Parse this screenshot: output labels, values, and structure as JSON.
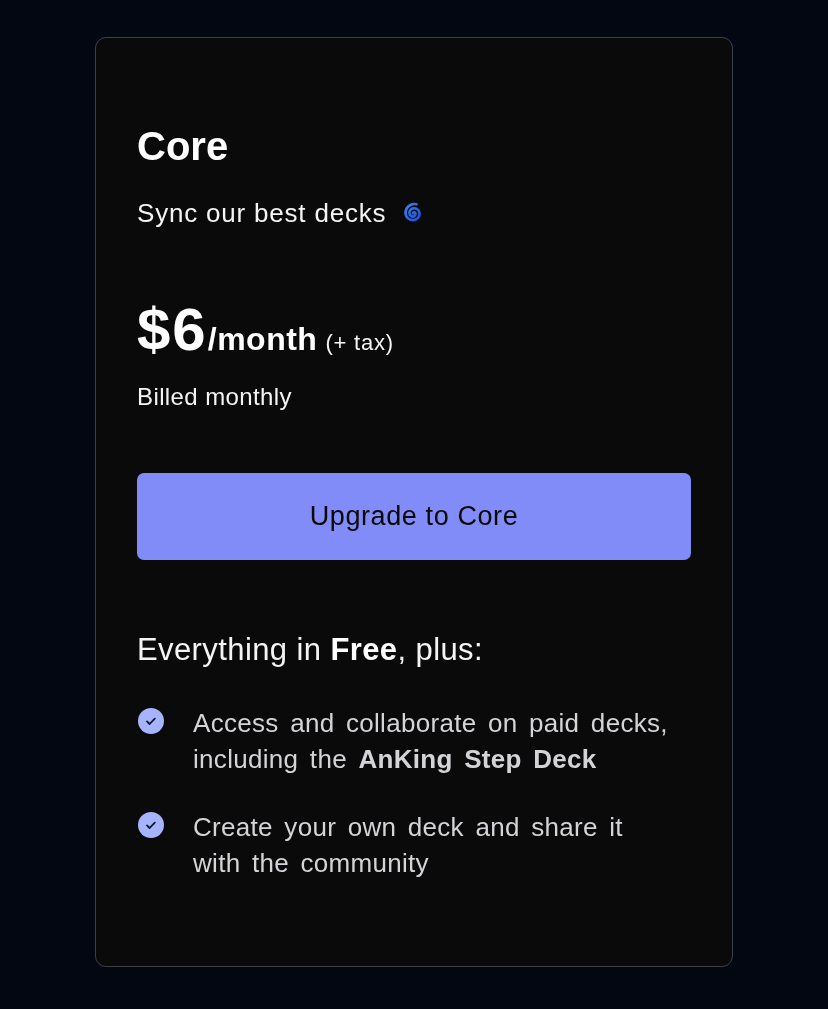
{
  "plan": {
    "name": "Core",
    "tagline": "Sync our best decks",
    "price": "$6",
    "period": "/month",
    "tax_note": "(+ tax)",
    "billing": "Billed monthly"
  },
  "cta": {
    "label": "Upgrade to Core"
  },
  "features": {
    "heading": "Everything in **Free**, plus:",
    "items": [
      {
        "text": "Access and collaborate on paid decks, including the **AnKing Step Deck**"
      },
      {
        "text": "Create your own deck and share it with the community"
      }
    ]
  }
}
